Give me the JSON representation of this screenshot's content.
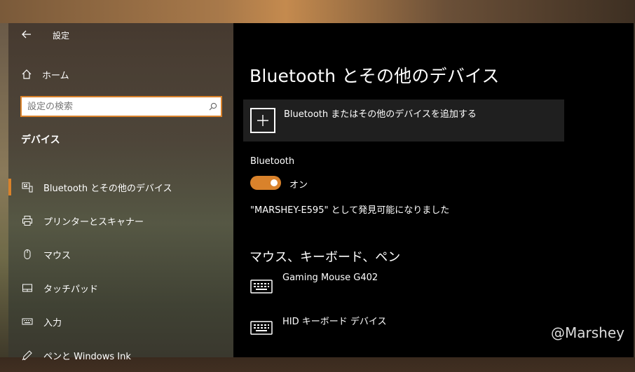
{
  "window": {
    "title": "設定"
  },
  "sidebar": {
    "home_label": "ホーム",
    "search_placeholder": "設定の検索",
    "section_title": "デバイス",
    "items": [
      {
        "label": "Bluetooth とその他のデバイス",
        "icon": "bluetooth-devices-icon",
        "selected": true
      },
      {
        "label": "プリンターとスキャナー",
        "icon": "printer-icon"
      },
      {
        "label": "マウス",
        "icon": "mouse-icon"
      },
      {
        "label": "タッチパッド",
        "icon": "touchpad-icon"
      },
      {
        "label": "入力",
        "icon": "keyboard-icon"
      },
      {
        "label": "ペンと Windows Ink",
        "icon": "pen-icon"
      }
    ]
  },
  "main": {
    "title": "Bluetooth とその他のデバイス",
    "add_device_label": "Bluetooth またはその他のデバイスを追加する",
    "bluetooth_label": "Bluetooth",
    "toggle_state": "オン",
    "discoverable_text": "\"MARSHEY-E595\" として発見可能になりました",
    "group_title": "マウス、キーボード、ペン",
    "devices": [
      {
        "name": "Gaming Mouse G402",
        "icon": "keyboard-icon"
      },
      {
        "name": "HID キーボード デバイス",
        "icon": "keyboard-icon"
      }
    ]
  },
  "watermark": "@Marshey",
  "colors": {
    "accent": "#d9822b",
    "content_bg": "#000000",
    "tile_bg": "#1f1f1f"
  }
}
